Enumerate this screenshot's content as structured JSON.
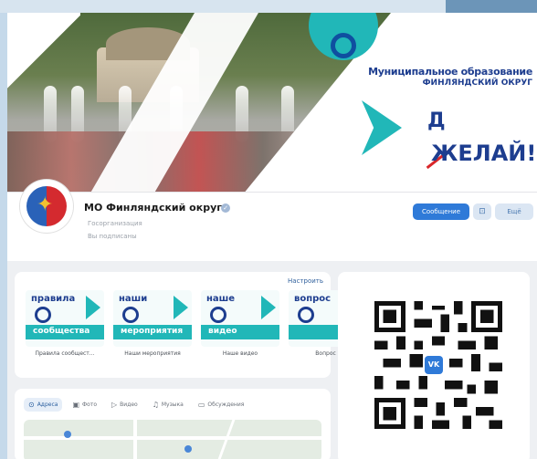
{
  "cover": {
    "org_title_line1": "Муниципальное образование",
    "org_title_line2": "ФИНЛЯНДСКИЙ ОКРУГ",
    "slogan_prefix": "Д",
    "slogan_main": "ЖЕЛАЙ!"
  },
  "profile": {
    "name": "МО Финляндский округ",
    "subtitle": "Госорганизация",
    "followers": "Вы подписаны",
    "message_button": "Сообщение",
    "more_button": "Ещё"
  },
  "apps": {
    "setup_link": "Настроить",
    "tiles": [
      {
        "line1": "правила",
        "line2": "сообщества",
        "caption": "Правила сообщест..."
      },
      {
        "line1": "наши",
        "line2": "мероприятия",
        "caption": "Наши мероприятия"
      },
      {
        "line1": "наше",
        "line2": "видео",
        "caption": "Наше видео"
      },
      {
        "line1": "вопрос",
        "line2": "",
        "caption": "Вопрос –"
      }
    ]
  },
  "tabs": [
    {
      "label": "Адреса",
      "icon": "pin-icon"
    },
    {
      "label": "Фото",
      "icon": "photo-icon"
    },
    {
      "label": "Видео",
      "icon": "video-icon"
    },
    {
      "label": "Музыка",
      "icon": "music-icon"
    },
    {
      "label": "Обсуждения",
      "icon": "chat-icon"
    }
  ],
  "qr": {
    "badge": "VK"
  },
  "colors": {
    "accent": "#2f7ad8",
    "teal": "#21b7b8",
    "navy": "#1d3d8f"
  }
}
